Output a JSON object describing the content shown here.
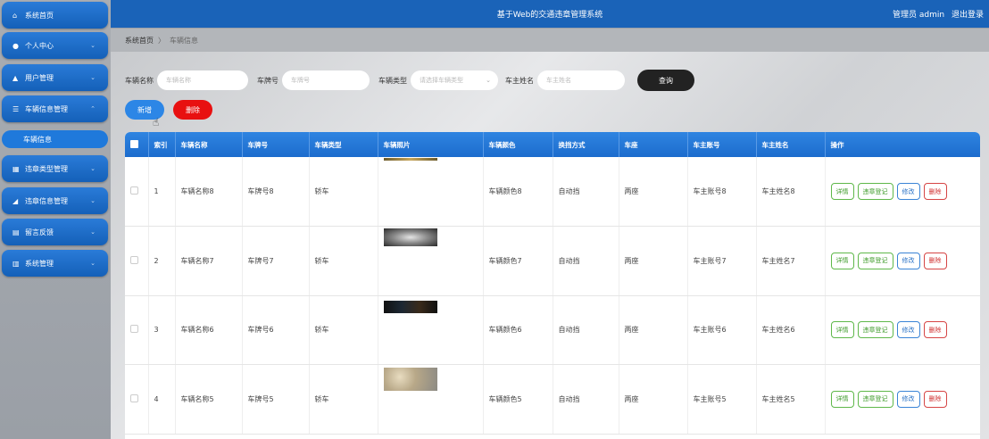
{
  "app": {
    "title": "基于Web的交通违章管理系统",
    "user_label": "管理员 admin",
    "logout_label": "退出登录"
  },
  "sidebar": {
    "items": [
      {
        "label": "系统首页",
        "icon": "home-icon"
      },
      {
        "label": "个人中心",
        "icon": "user-icon"
      },
      {
        "label": "用户管理",
        "icon": "users-icon"
      },
      {
        "label": "车辆信息管理",
        "icon": "list-icon"
      },
      {
        "label": "违章类型管理",
        "icon": "grid-icon"
      },
      {
        "label": "违章信息管理",
        "icon": "chart-icon"
      },
      {
        "label": "留言反馈",
        "icon": "doc-icon"
      },
      {
        "label": "系统管理",
        "icon": "bars-icon"
      }
    ],
    "active_sub": "车辆信息"
  },
  "breadcrumb": {
    "home": "系统首页",
    "separator": "〉",
    "current": "车辆信息"
  },
  "search": {
    "name_label": "车辆名称",
    "name_placeholder": "车辆名称",
    "plate_label": "车牌号",
    "plate_placeholder": "车牌号",
    "type_label": "车辆类型",
    "type_placeholder": "请选择车辆类型",
    "owner_label": "车主姓名",
    "owner_placeholder": "车主姓名",
    "query_label": "查询"
  },
  "actions": {
    "add_label": "新增",
    "delete_label": "删除"
  },
  "table": {
    "headers": [
      "索引",
      "车辆名称",
      "车牌号",
      "车辆类型",
      "车辆照片",
      "车辆颜色",
      "换挡方式",
      "车座",
      "车主账号",
      "车主姓名",
      "操作"
    ],
    "row_actions": {
      "detail": "详情",
      "register": "违章登记",
      "edit": "修改",
      "delete": "删除"
    },
    "rows": [
      {
        "index": "1",
        "name": "车辆名称8",
        "plate": "车牌号8",
        "type": "轿车",
        "color": "车辆颜色8",
        "gear": "自动挡",
        "seats": "两座",
        "owner_account": "车主账号8",
        "owner_name": "车主姓名8"
      },
      {
        "index": "2",
        "name": "车辆名称7",
        "plate": "车牌号7",
        "type": "轿车",
        "color": "车辆颜色7",
        "gear": "自动挡",
        "seats": "两座",
        "owner_account": "车主账号7",
        "owner_name": "车主姓名7"
      },
      {
        "index": "3",
        "name": "车辆名称6",
        "plate": "车牌号6",
        "type": "轿车",
        "color": "车辆颜色6",
        "gear": "自动挡",
        "seats": "两座",
        "owner_account": "车主账号6",
        "owner_name": "车主姓名6"
      },
      {
        "index": "4",
        "name": "车辆名称5",
        "plate": "车牌号5",
        "type": "轿车",
        "color": "车辆颜色5",
        "gear": "自动挡",
        "seats": "两座",
        "owner_account": "车主账号5",
        "owner_name": "车主姓名5"
      }
    ]
  },
  "colors": {
    "primary": "#1a63b8",
    "danger": "#e81010",
    "query": "#222222"
  }
}
